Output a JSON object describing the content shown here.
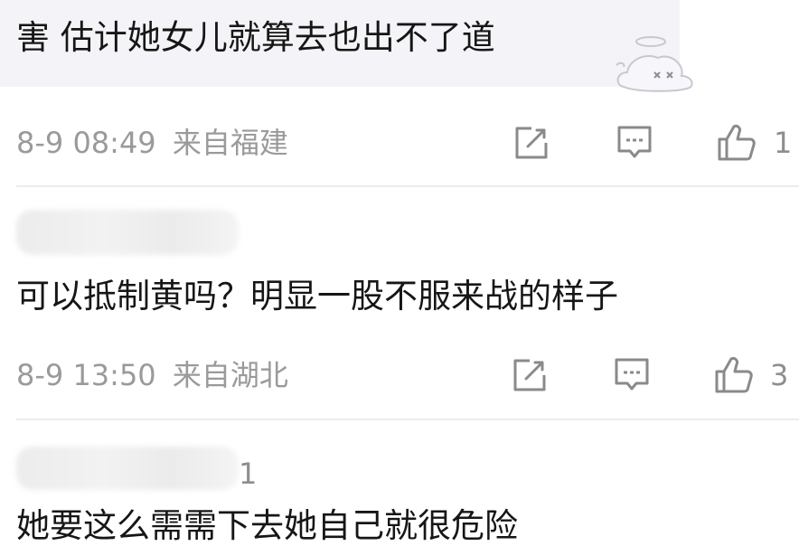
{
  "comments": [
    {
      "text": "害 估计她女儿就算去也出不了道",
      "timestamp": "8-9 08:49",
      "location": "来自福建",
      "likes": "1",
      "sticker": "dizzy-angel-ghost"
    },
    {
      "author_blurred": true,
      "text": "可以抵制黄吗？明显一股不服来战的样子",
      "timestamp": "8-9 13:50",
      "location": "来自湖北",
      "likes": "3"
    },
    {
      "author_blurred": true,
      "author_partial_suffix": "1",
      "text_partial": "她要这么需需下去她自己就很危险"
    }
  ],
  "icons": {
    "share": "share-icon",
    "comment": "comment-icon",
    "like": "like-icon"
  },
  "colors": {
    "bubble_background": "#f4f3f7",
    "text": "#161616",
    "meta": "#9a9a9a",
    "icon": "#8a8a8a",
    "divider": "#ececec"
  }
}
